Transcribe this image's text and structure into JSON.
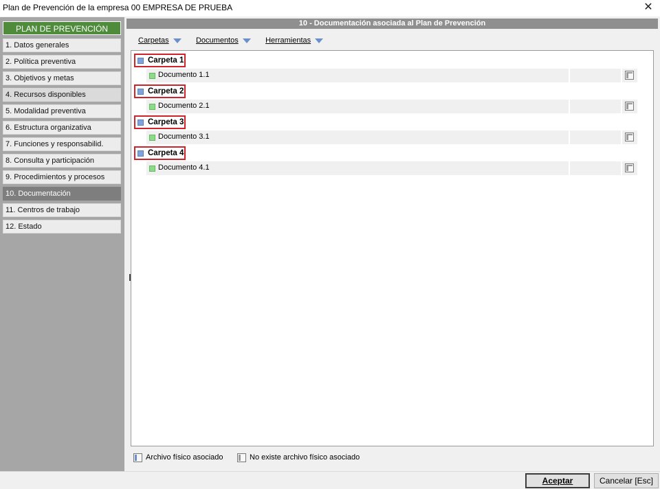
{
  "window": {
    "title": "Plan de Prevención de la empresa 00 EMPRESA DE PRUEBA",
    "close_glyph": "✕"
  },
  "sidebar": {
    "header": "PLAN DE PREVENCIÓN",
    "items": [
      {
        "label": "1. Datos generales"
      },
      {
        "label": "2. Política preventiva"
      },
      {
        "label": "3. Objetivos y metas"
      },
      {
        "label": "4. Recursos disponibles"
      },
      {
        "label": "5. Modalidad preventiva"
      },
      {
        "label": "6. Estructura organizativa"
      },
      {
        "label": "7. Funciones y responsabilid."
      },
      {
        "label": "8. Consulta y participación"
      },
      {
        "label": "9. Procedimientos y procesos"
      },
      {
        "label": "10. Documentación"
      },
      {
        "label": "11. Centros de trabajo"
      },
      {
        "label": "12. Estado"
      }
    ],
    "active_index": 9
  },
  "panel": {
    "title": "10 - Documentación asociada al Plan de Prevención"
  },
  "menubar": {
    "items": [
      {
        "label": "Carpetas"
      },
      {
        "label": "Documentos"
      },
      {
        "label": "Herramientas"
      }
    ]
  },
  "tree": {
    "folders": [
      {
        "name": "Carpeta 1",
        "document": "Documento 1.1"
      },
      {
        "name": "Carpeta 2",
        "document": "Documento 2.1"
      },
      {
        "name": "Carpeta 3",
        "document": "Documento 3.1"
      },
      {
        "name": "Carpeta 4",
        "document": "Documento 4.1"
      }
    ]
  },
  "legend": {
    "has_file": "Archivo físico asociado",
    "no_file": "No existe archivo físico asociado"
  },
  "buttons": {
    "accept": "Aceptar",
    "cancel": "Cancelar [Esc]"
  },
  "colors": {
    "accent_green": "#4e8c3c",
    "highlight_red": "#d0222a",
    "folder_icon": "#7fa3d9",
    "document_icon": "#8fd98a"
  },
  "icons": {
    "folder": "folder-icon",
    "document": "document-icon",
    "file": "file-attached-icon",
    "dropdown": "chevron-down-icon"
  }
}
